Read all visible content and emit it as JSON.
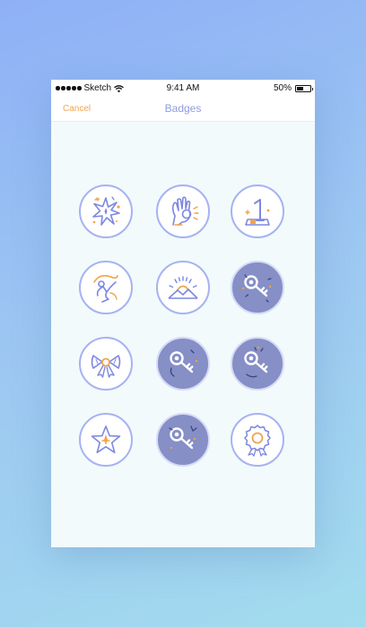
{
  "status_bar": {
    "carrier": "Sketch",
    "time": "9:41 AM",
    "battery_text": "50%",
    "battery_level": 0.5
  },
  "nav": {
    "cancel_label": "Cancel",
    "title": "Badges"
  },
  "badges": [
    {
      "icon": "starburst-icon",
      "locked": false
    },
    {
      "icon": "ok-hand-icon",
      "locked": false
    },
    {
      "icon": "number-one-icon",
      "locked": false
    },
    {
      "icon": "dancer-icon",
      "locked": false
    },
    {
      "icon": "sunrise-icon",
      "locked": false
    },
    {
      "icon": "key-icon",
      "locked": true
    },
    {
      "icon": "bow-icon",
      "locked": false
    },
    {
      "icon": "key-icon",
      "locked": true
    },
    {
      "icon": "key-icon",
      "locked": true
    },
    {
      "icon": "star-icon",
      "locked": false
    },
    {
      "icon": "key-icon",
      "locked": true
    },
    {
      "icon": "rosette-icon",
      "locked": false
    }
  ],
  "colors": {
    "accent": "#f0a550",
    "title": "#8f9ce0",
    "badge_border": "#a6b2f3",
    "locked_fill": "#868fc6",
    "line": "#7d88e0",
    "orange": "#f3a24a",
    "screen_bg": "#f2fafb"
  }
}
